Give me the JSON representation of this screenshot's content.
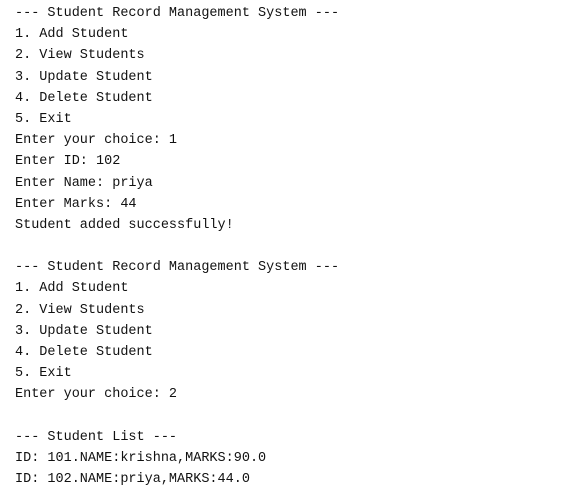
{
  "console": {
    "session1": {
      "header": "--- Student Record Management System ---",
      "menu": [
        "1. Add Student",
        "2. View Students",
        "3. Update Student",
        "4. Delete Student",
        "5. Exit"
      ],
      "choice_prompt": "Enter your choice: 1",
      "id_prompt": "Enter ID: 102",
      "name_prompt": "Enter Name: priya",
      "marks_prompt": "Enter Marks: 44",
      "result": "Student added successfully!"
    },
    "session2": {
      "header": "--- Student Record Management System ---",
      "menu": [
        "1. Add Student",
        "2. View Students",
        "3. Update Student",
        "4. Delete Student",
        "5. Exit"
      ],
      "choice_prompt": "Enter your choice: 2"
    },
    "student_list": {
      "header": "--- Student List ---",
      "rows": [
        "ID: 101.NAME:krishna,MARKS:90.0",
        "ID: 102.NAME:priya,MARKS:44.0"
      ]
    }
  }
}
